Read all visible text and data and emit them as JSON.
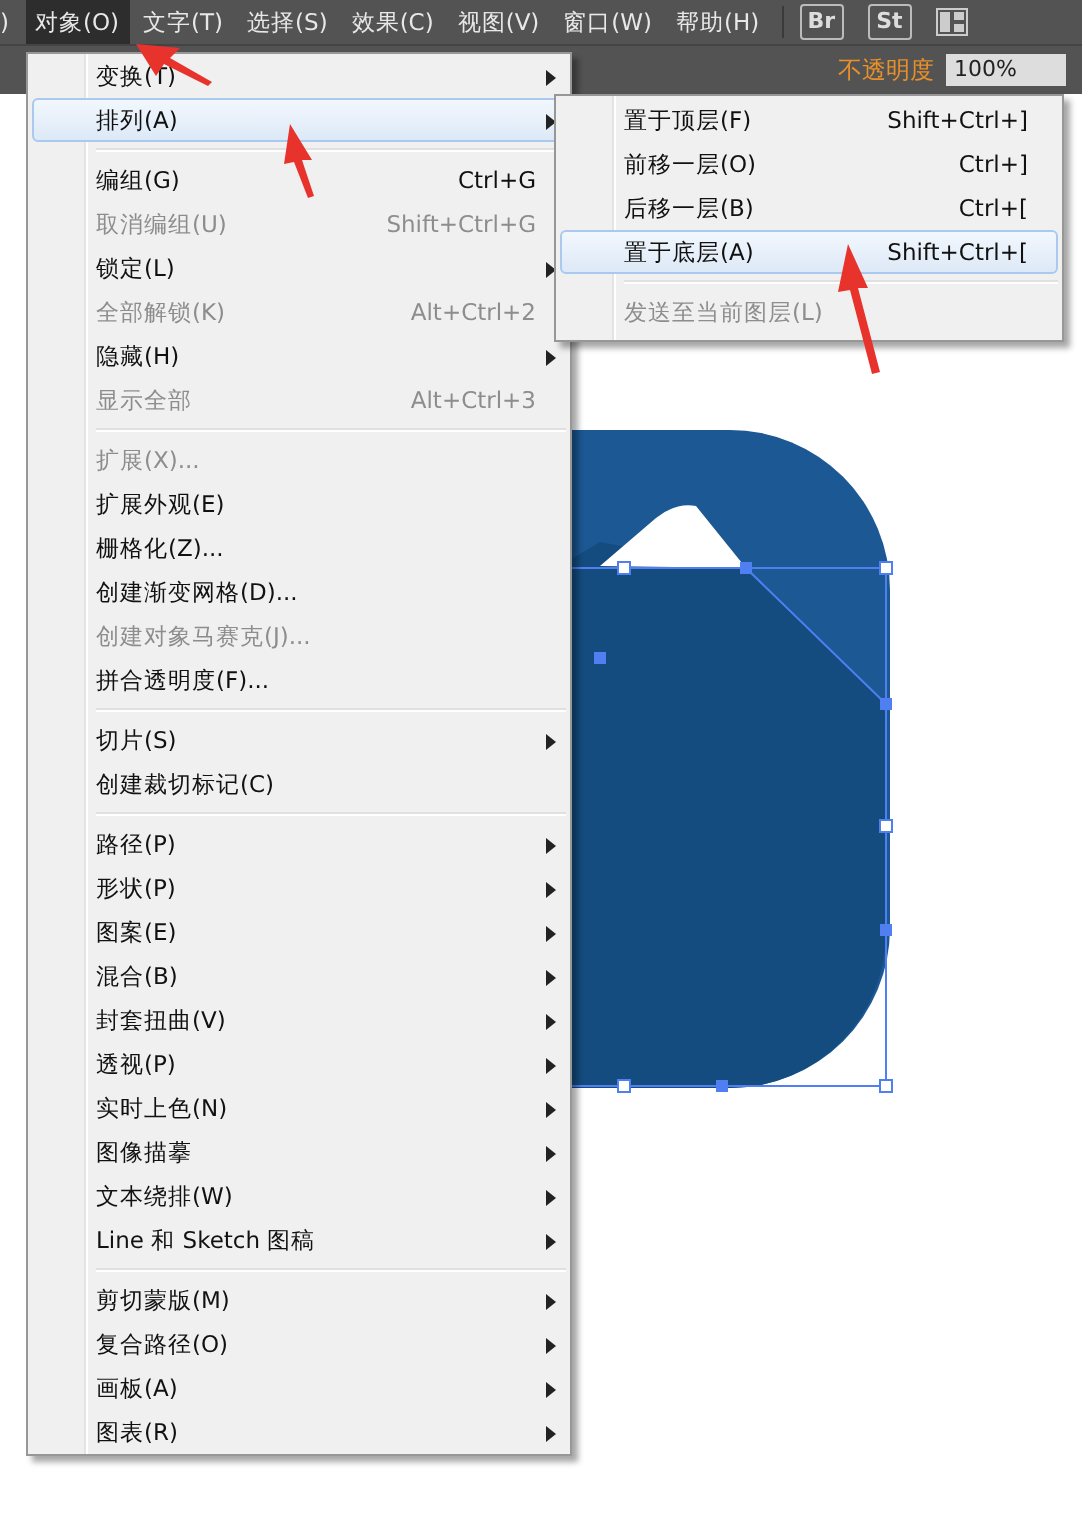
{
  "menubar": {
    "items": [
      {
        "label": ")",
        "selected": false
      },
      {
        "label": "对象(O)",
        "selected": true
      },
      {
        "label": "文字(T)",
        "selected": false
      },
      {
        "label": "选择(S)",
        "selected": false
      },
      {
        "label": "效果(C)",
        "selected": false
      },
      {
        "label": "视图(V)",
        "selected": false
      },
      {
        "label": "窗口(W)",
        "selected": false
      },
      {
        "label": "帮助(H)",
        "selected": false
      }
    ],
    "app_buttons": [
      "Br",
      "St"
    ]
  },
  "control_bar": {
    "opacity_label": "不透明度",
    "opacity_value": "100%"
  },
  "object_menu": {
    "groups": [
      [
        {
          "label": "变换(T)",
          "submenu": true,
          "disabled": false,
          "selected": false
        },
        {
          "label": "排列(A)",
          "submenu": true,
          "disabled": false,
          "selected": true
        }
      ],
      [
        {
          "label": "编组(G)",
          "shortcut": "Ctrl+G",
          "submenu": false,
          "disabled": false,
          "selected": false
        },
        {
          "label": "取消编组(U)",
          "shortcut": "Shift+Ctrl+G",
          "submenu": false,
          "disabled": true,
          "selected": false
        },
        {
          "label": "锁定(L)",
          "submenu": true,
          "disabled": false,
          "selected": false
        },
        {
          "label": "全部解锁(K)",
          "shortcut": "Alt+Ctrl+2",
          "submenu": false,
          "disabled": true,
          "selected": false
        },
        {
          "label": "隐藏(H)",
          "submenu": true,
          "disabled": false,
          "selected": false
        },
        {
          "label": "显示全部",
          "shortcut": "Alt+Ctrl+3",
          "submenu": false,
          "disabled": true,
          "selected": false
        }
      ],
      [
        {
          "label": "扩展(X)...",
          "submenu": false,
          "disabled": true,
          "selected": false
        },
        {
          "label": "扩展外观(E)",
          "submenu": false,
          "disabled": false,
          "selected": false
        },
        {
          "label": "栅格化(Z)...",
          "submenu": false,
          "disabled": false,
          "selected": false
        },
        {
          "label": "创建渐变网格(D)...",
          "submenu": false,
          "disabled": false,
          "selected": false
        },
        {
          "label": "创建对象马赛克(J)...",
          "submenu": false,
          "disabled": true,
          "selected": false
        },
        {
          "label": "拼合透明度(F)...",
          "submenu": false,
          "disabled": false,
          "selected": false
        }
      ],
      [
        {
          "label": "切片(S)",
          "submenu": true,
          "disabled": false,
          "selected": false
        },
        {
          "label": "创建裁切标记(C)",
          "submenu": false,
          "disabled": false,
          "selected": false
        }
      ],
      [
        {
          "label": "路径(P)",
          "submenu": true,
          "disabled": false,
          "selected": false
        },
        {
          "label": "形状(P)",
          "submenu": true,
          "disabled": false,
          "selected": false
        },
        {
          "label": "图案(E)",
          "submenu": true,
          "disabled": false,
          "selected": false
        },
        {
          "label": "混合(B)",
          "submenu": true,
          "disabled": false,
          "selected": false
        },
        {
          "label": "封套扭曲(V)",
          "submenu": true,
          "disabled": false,
          "selected": false
        },
        {
          "label": "透视(P)",
          "submenu": true,
          "disabled": false,
          "selected": false
        },
        {
          "label": "实时上色(N)",
          "submenu": true,
          "disabled": false,
          "selected": false
        },
        {
          "label": "图像描摹",
          "submenu": true,
          "disabled": false,
          "selected": false
        },
        {
          "label": "文本绕排(W)",
          "submenu": true,
          "disabled": false,
          "selected": false
        },
        {
          "label": "Line 和 Sketch 图稿",
          "submenu": true,
          "disabled": false,
          "selected": false
        }
      ],
      [
        {
          "label": "剪切蒙版(M)",
          "submenu": true,
          "disabled": false,
          "selected": false
        },
        {
          "label": "复合路径(O)",
          "submenu": true,
          "disabled": false,
          "selected": false
        },
        {
          "label": "画板(A)",
          "submenu": true,
          "disabled": false,
          "selected": false
        },
        {
          "label": "图表(R)",
          "submenu": true,
          "disabled": false,
          "selected": false
        }
      ]
    ]
  },
  "arrange_submenu": {
    "groups": [
      [
        {
          "label": "置于顶层(F)",
          "shortcut": "Shift+Ctrl+]",
          "disabled": false,
          "selected": false
        },
        {
          "label": "前移一层(O)",
          "shortcut": "Ctrl+]",
          "disabled": false,
          "selected": false
        },
        {
          "label": "后移一层(B)",
          "shortcut": "Ctrl+[",
          "disabled": false,
          "selected": false
        },
        {
          "label": "置于底层(A)",
          "shortcut": "Shift+Ctrl+[",
          "disabled": false,
          "selected": true
        }
      ],
      [
        {
          "label": "发送至当前图层(L)",
          "disabled": true,
          "selected": false
        }
      ]
    ]
  }
}
